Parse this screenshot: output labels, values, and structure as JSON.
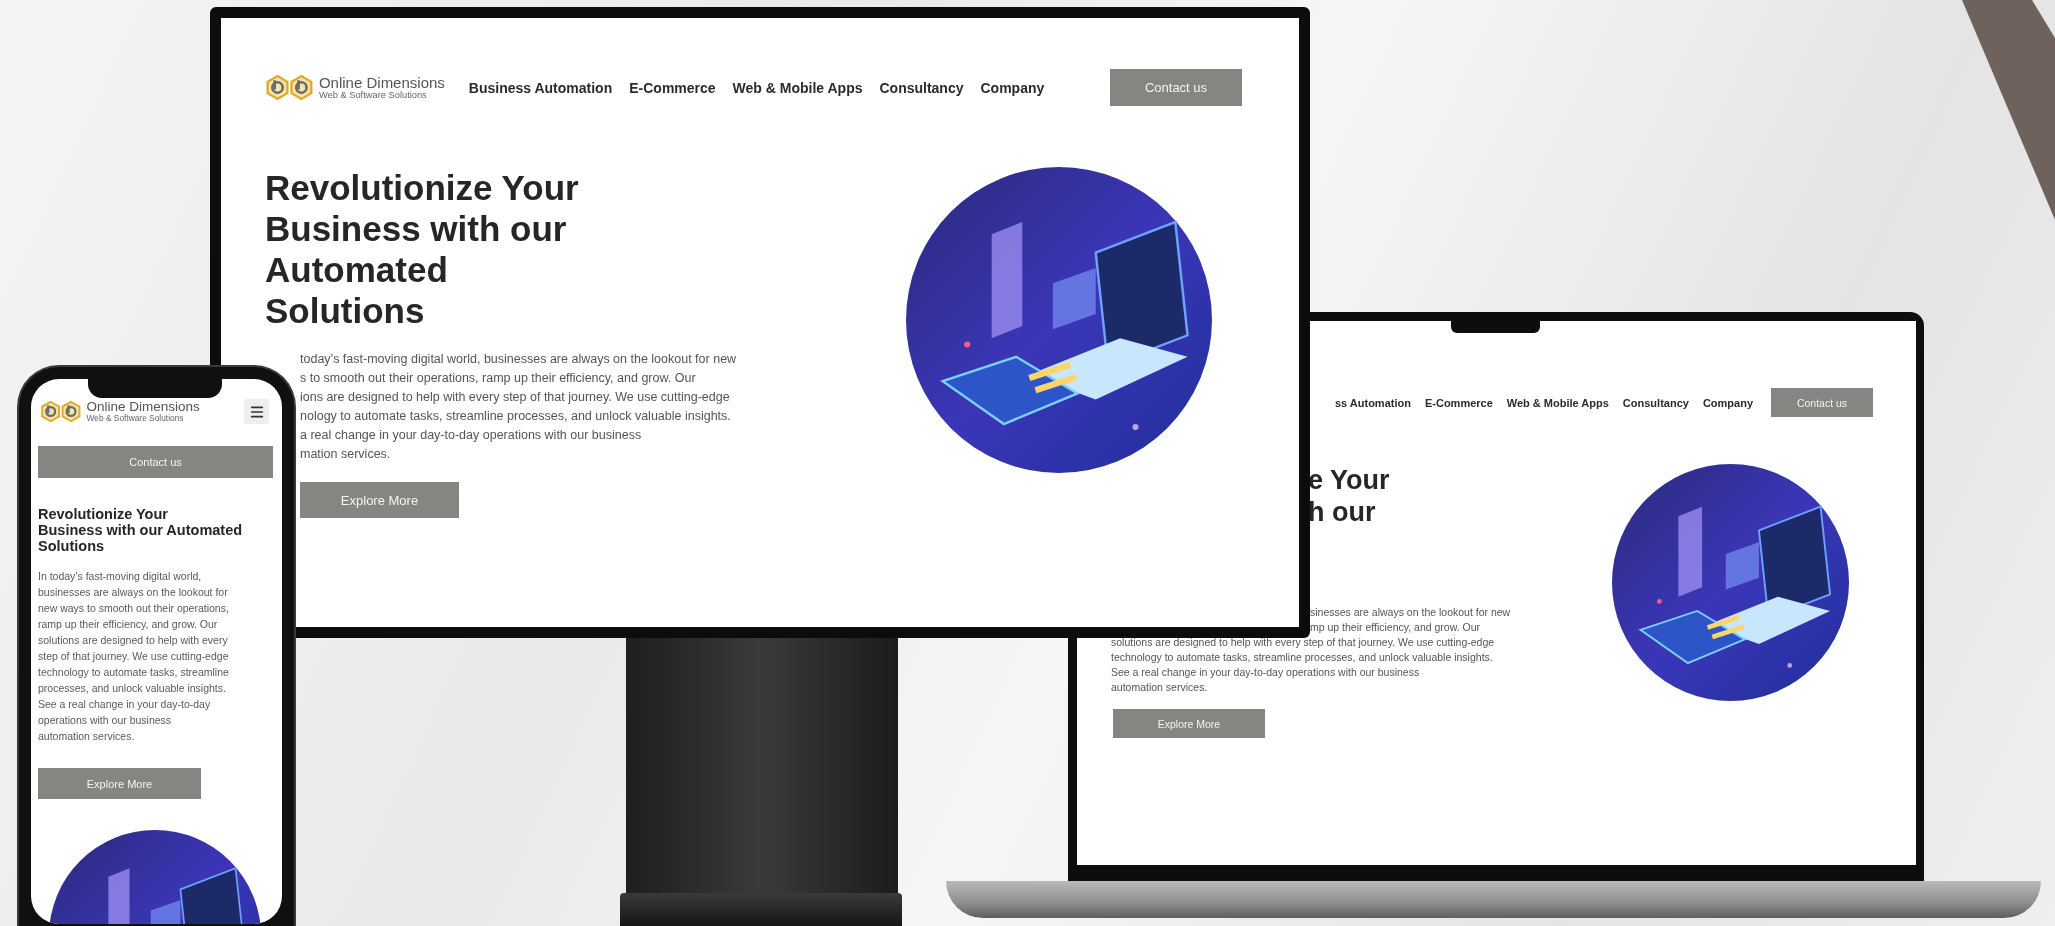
{
  "monitor": {
    "brand": {
      "name": "Online Dimensions",
      "tagline": "Web & Software Solutions"
    },
    "nav": [
      "Business Automation",
      "E-Commerce",
      "Web & Mobile Apps",
      "Consultancy",
      "Company"
    ],
    "cta": "Contact us",
    "headline_lines": [
      "Revolutionize Your",
      "Business with our",
      "Automated",
      "Solutions"
    ],
    "body_lines": [
      "today’s fast-moving digital world, businesses are always on the lookout for new",
      "s to smooth out their operations, ramp up their efficiency, and grow. Our",
      "ions are designed to help with every step of that journey. We use cutting-edge",
      "nology to automate tasks, streamline processes, and unlock valuable insights.",
      "a real change in your day-to-day operations with our business",
      "mation services."
    ],
    "button": "Explore More"
  },
  "laptop": {
    "nav": [
      "ss Automation",
      "E-Commerce",
      "Web & Mobile Apps",
      "Consultancy",
      "Company"
    ],
    "cta": "Contact us",
    "headline_lines": [
      "e Your",
      "h our"
    ],
    "body_lines_upper": [
      "sinesses are always on the lookout for new",
      "mp up their efficiency, and grow. Our"
    ],
    "body_lines_lower": [
      "solutions are designed to help with every step of that journey. We use cutting-edge",
      "technology to automate tasks, streamline processes, and unlock valuable insights.",
      "See a real change in your day-to-day operations with our business",
      "automation services."
    ],
    "button": "Explore More"
  },
  "phone": {
    "brand": {
      "name": "Online Dimensions",
      "tagline": "Web & Software Solutions"
    },
    "cta": "Contact us",
    "headline_lines": [
      "Revolutionize Your",
      "Business with our Automated",
      "Solutions"
    ],
    "body_lines": [
      "In today’s fast-moving digital world,",
      "businesses are always on the lookout for",
      "new ways to smooth out their operations,",
      "ramp up their efficiency, and grow. Our",
      "solutions are designed to help with every",
      "step of that journey. We use cutting-edge",
      "technology to automate tasks, streamline",
      "processes, and unlock valuable insights.",
      "See a real change in your day-to-day",
      "operations with our business",
      "automation services."
    ],
    "button": "Explore More"
  }
}
